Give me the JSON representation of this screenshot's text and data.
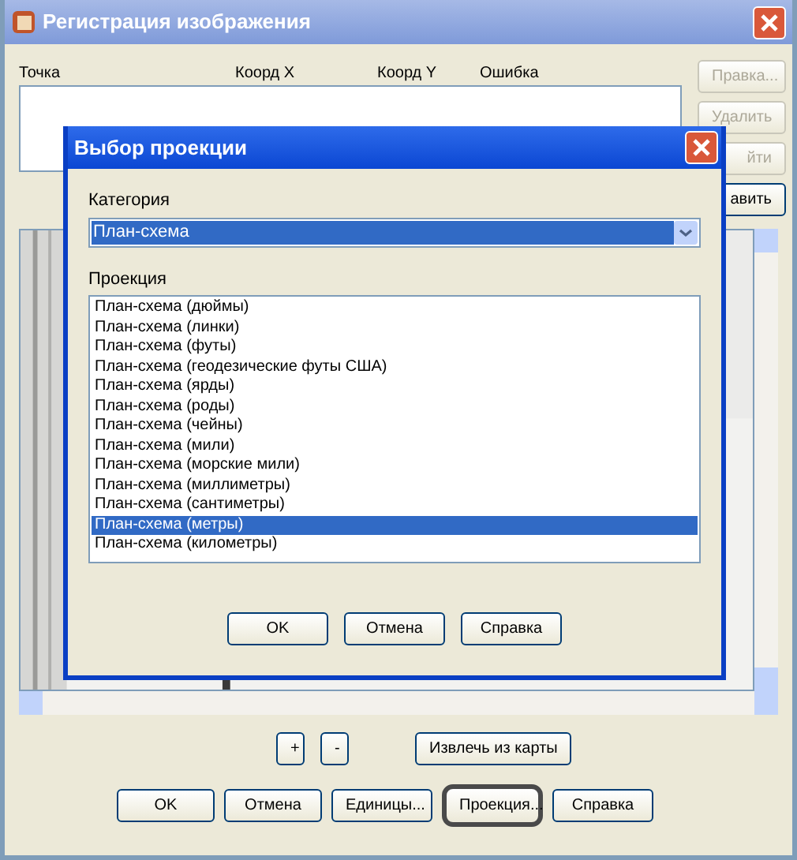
{
  "window": {
    "title": "Регистрация изображения"
  },
  "points_table": {
    "columns": [
      "Точка",
      "Коорд X",
      "Коорд Y",
      "Ошибка"
    ]
  },
  "side_buttons": [
    {
      "label": "Правка...",
      "disabled": true
    },
    {
      "label": "Удалить",
      "disabled": true
    },
    {
      "label": "йти",
      "disabled": true
    },
    {
      "label": "авить",
      "disabled": false
    }
  ],
  "image": {
    "kind": "picture"
  },
  "zoom_buttons": [
    "+",
    "-"
  ],
  "extract_button": "Извлечь из карты",
  "bottom_buttons": [
    {
      "label": "OK",
      "highlighted": false
    },
    {
      "label": "Отмена",
      "highlighted": false
    },
    {
      "label": "Единицы...",
      "highlighted": false
    },
    {
      "label": "Проекция...",
      "highlighted": true
    },
    {
      "label": "Справка",
      "highlighted": false
    }
  ],
  "dialog": {
    "title": "Выбор проекции",
    "category_label": "Категория",
    "category_value": "План-схема",
    "projection_label": "Проекция",
    "projections": [
      {
        "label": "План-схема (дюймы)",
        "selected": false
      },
      {
        "label": "План-схема (линки)",
        "selected": false
      },
      {
        "label": "План-схема (футы)",
        "selected": false
      },
      {
        "label": "План-схема (геодезические футы США)",
        "selected": false
      },
      {
        "label": "План-схема (ярды)",
        "selected": false
      },
      {
        "label": "План-схема (роды)",
        "selected": false
      },
      {
        "label": "План-схема (чейны)",
        "selected": false
      },
      {
        "label": "План-схема (мили)",
        "selected": false
      },
      {
        "label": "План-схема (морские мили)",
        "selected": false
      },
      {
        "label": "План-схема (миллиметры)",
        "selected": false
      },
      {
        "label": "План-схема (сантиметры)",
        "selected": false
      },
      {
        "label": "План-схема (метры)",
        "selected": true
      },
      {
        "label": "План-схема (километры)",
        "selected": false
      }
    ],
    "buttons": [
      "OK",
      "Отмена",
      "Справка"
    ]
  }
}
